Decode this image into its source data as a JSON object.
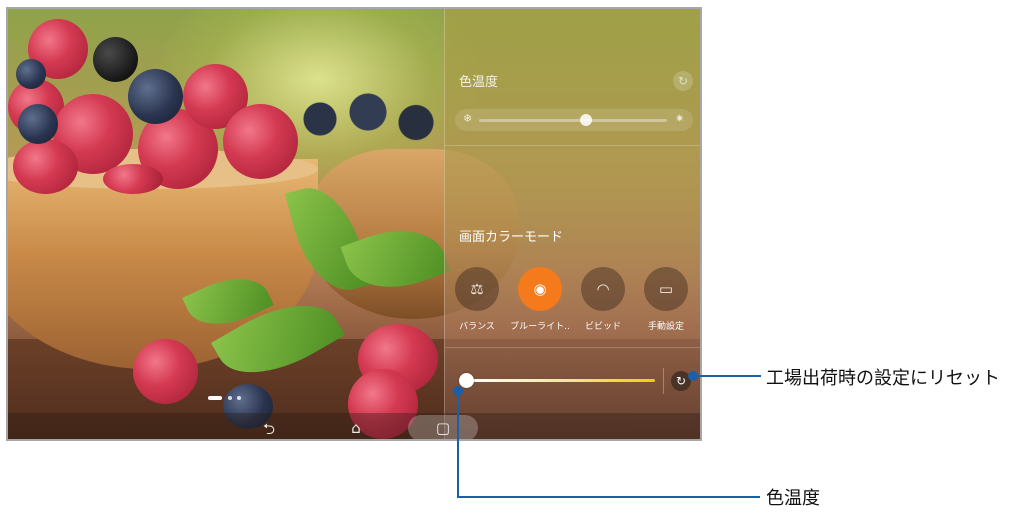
{
  "panel": {
    "color_temp_title": "色温度",
    "color_mode_title": "画面カラーモード",
    "modes": [
      {
        "label": "バランス",
        "icon": "balance-scale-icon",
        "glyph": "⚖",
        "active": false
      },
      {
        "label": "ブルーライト..",
        "icon": "eye-shield-icon",
        "glyph": "◉",
        "active": true
      },
      {
        "label": "ビビッド",
        "icon": "rainbow-arcs-icon",
        "glyph": "◠",
        "active": false
      },
      {
        "label": "手動設定",
        "icon": "custom-settings-icon",
        "glyph": "▭",
        "active": false
      }
    ],
    "color_temp_level": 0.57,
    "bluelight_level": 0.0
  },
  "navbar": {
    "back": "⮌",
    "home": "⌂",
    "recent": "▢"
  },
  "callouts": {
    "reset_label": "工場出荷時の設定にリセット",
    "color_temp_label": "色温度"
  },
  "colors": {
    "accent_orange": "#f47a1c",
    "callout_blue": "#1b5fa8"
  }
}
